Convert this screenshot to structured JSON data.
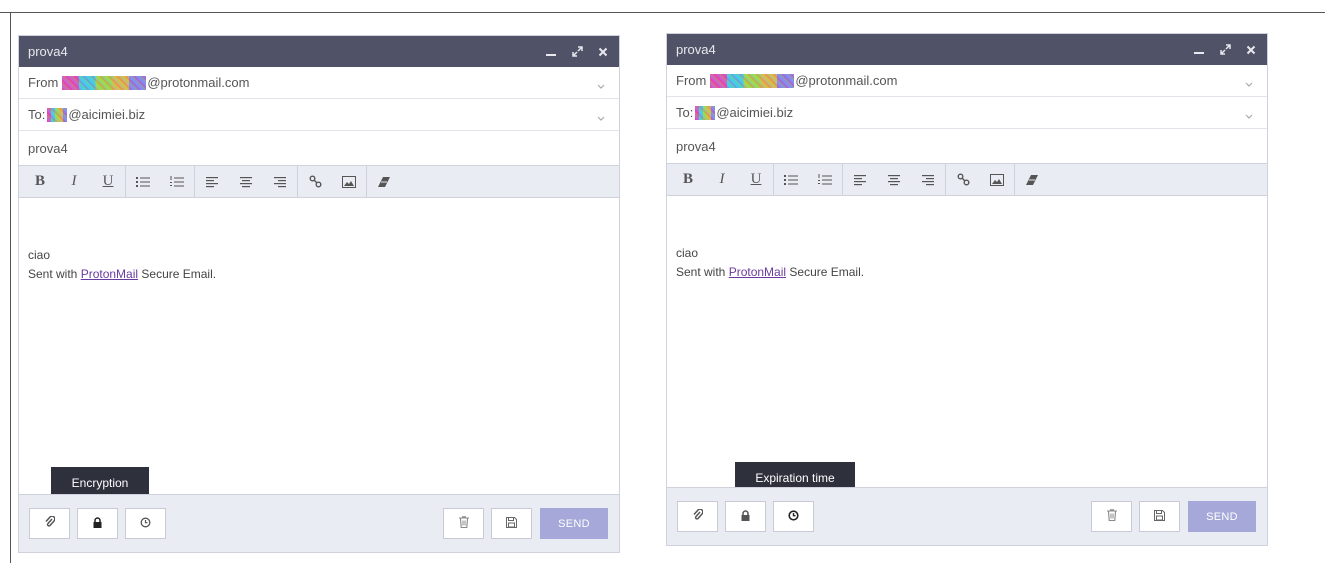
{
  "composer_left": {
    "title": "prova4",
    "from_label": "From",
    "from_domain": "@protonmail.com",
    "to_label": "To:",
    "to_domain": "@aicimiei.biz",
    "subject": "prova4",
    "toolbar": {
      "bold": "B",
      "italic": "I",
      "underline": "U"
    },
    "body_line1": "ciao",
    "signature_prefix": "Sent with ",
    "signature_link": "ProtonMail",
    "signature_suffix": " Secure Email.",
    "send_label": "SEND",
    "tooltip": "Encryption"
  },
  "composer_right": {
    "title": "prova4",
    "from_label": "From",
    "from_domain": "@protonmail.com",
    "to_label": "To:",
    "to_domain": "@aicimiei.biz",
    "subject": "prova4",
    "toolbar": {
      "bold": "B",
      "italic": "I",
      "underline": "U"
    },
    "body_line1": "ciao",
    "signature_prefix": "Sent with ",
    "signature_link": "ProtonMail",
    "signature_suffix": " Secure Email.",
    "send_label": "SEND",
    "tooltip": "Expiration time"
  },
  "colors": {
    "titlebar": "#505367",
    "toolbar_bg": "#eaecf3",
    "send_button": "#a5a8d9",
    "tooltip_bg": "#2e303c",
    "link": "#6a3aa0"
  },
  "icons": [
    "minimize-icon",
    "expand-icon",
    "close-icon",
    "chevron-down-icon",
    "bulleted-list-icon",
    "numbered-list-icon",
    "align-left-icon",
    "align-center-icon",
    "align-right-icon",
    "link-icon",
    "image-icon",
    "clear-format-icon",
    "paperclip-icon",
    "lock-icon",
    "clock-icon",
    "trash-icon",
    "save-icon"
  ]
}
